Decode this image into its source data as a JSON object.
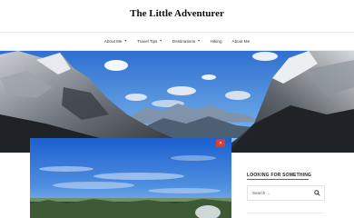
{
  "site": {
    "title": "The Little Adventurer"
  },
  "nav": {
    "items": [
      {
        "label": "About Me",
        "has_dropdown": true
      },
      {
        "label": "Travel Tips",
        "has_dropdown": true
      },
      {
        "label": "Destinations",
        "has_dropdown": true
      },
      {
        "label": "Hiking",
        "has_dropdown": false
      },
      {
        "label": "About Me",
        "has_dropdown": false
      }
    ],
    "dropdown_icon": "chevron-down-icon"
  },
  "hero": {
    "image": "mountain-valley-landscape"
  },
  "post": {
    "image": "blue-sky-forest-landscape",
    "close_icon": "close-icon"
  },
  "sidebar": {
    "widget_title": "LOOKING FOR SOMETHING",
    "search": {
      "placeholder": "Search ...",
      "icon": "search-icon"
    }
  },
  "colors": {
    "accent": "#d33b2c",
    "close_button": "#e23a2a"
  }
}
